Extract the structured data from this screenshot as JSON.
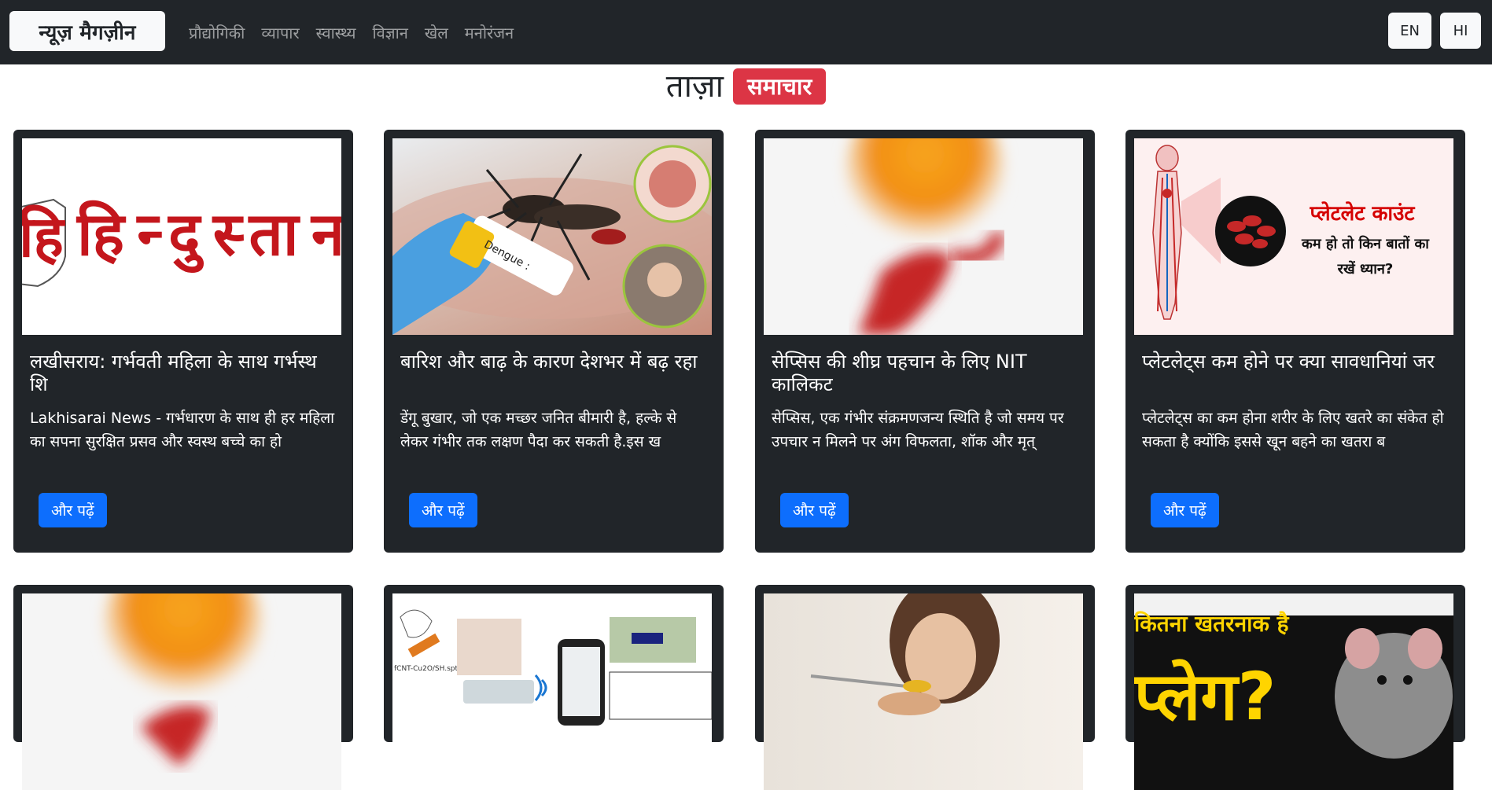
{
  "nav": {
    "brand": "न्यूज़ मैगज़ीन",
    "links": [
      "प्रौद्योगिकी",
      "व्यापार",
      "स्वास्थ्य",
      "विज्ञान",
      "खेल",
      "मनोरंजन"
    ],
    "lang_en": "EN",
    "lang_hi": "HI"
  },
  "heading": {
    "main": "ताज़ा",
    "badge": "समाचार"
  },
  "read_more": "और पढ़ें",
  "cards": [
    {
      "title": "लखीसराय: गर्भवती महिला के साथ गर्भस्थ शि",
      "text": "Lakhisarai News - गर्भधारण के साथ ही हर महिला का सपना सुरक्षित प्रसव और स्वस्थ बच्चे का हो",
      "image_text": "हिन्दुस्तान",
      "image_logo": "हि"
    },
    {
      "title": "बारिश और बाढ़ के कारण देशभर में बढ़ रहा",
      "text": "डेंगू बुखार, जो एक मच्छर जनित बीमारी है, हल्के से लेकर गंभीर तक लक्षण पैदा कर सकती है.इस ख",
      "image_text": "Dengue :"
    },
    {
      "title": "सेप्सिस की शीघ्र पहचान के लिए NIT कालिकट",
      "text": "सेप्सिस, एक गंभीर संक्रमणजन्य स्थिति है जो समय पर उपचार न मिलने पर अंग विफलता, शॉक और मृत्",
      "image_text": ""
    },
    {
      "title": "प्लेटलेट्स कम होने पर क्या सावधानियां जर",
      "text": "प्लेटलेट्स का कम होना शरीर के लिए खतरे का संकेत हो सकता है क्योंकि इससे खून बहने का खतरा ब",
      "image_title": "प्लेटलेट काउंट",
      "image_sub1": "कम हो तो किन बातों का",
      "image_sub2": "रखें ध्यान?"
    }
  ],
  "cards_row2": [
    {
      "image_text": ""
    },
    {
      "image_text": "fCNT-Cu2O/SH.spt"
    },
    {
      "image_text": ""
    },
    {
      "image_title": "कितना खतरनाक है",
      "image_big": "प्लेग?"
    }
  ],
  "colors": {
    "navbar": "#212529",
    "card": "#212529",
    "badge": "#dc3545",
    "button": "#0d6efd",
    "brand_red": "#c4161c"
  }
}
